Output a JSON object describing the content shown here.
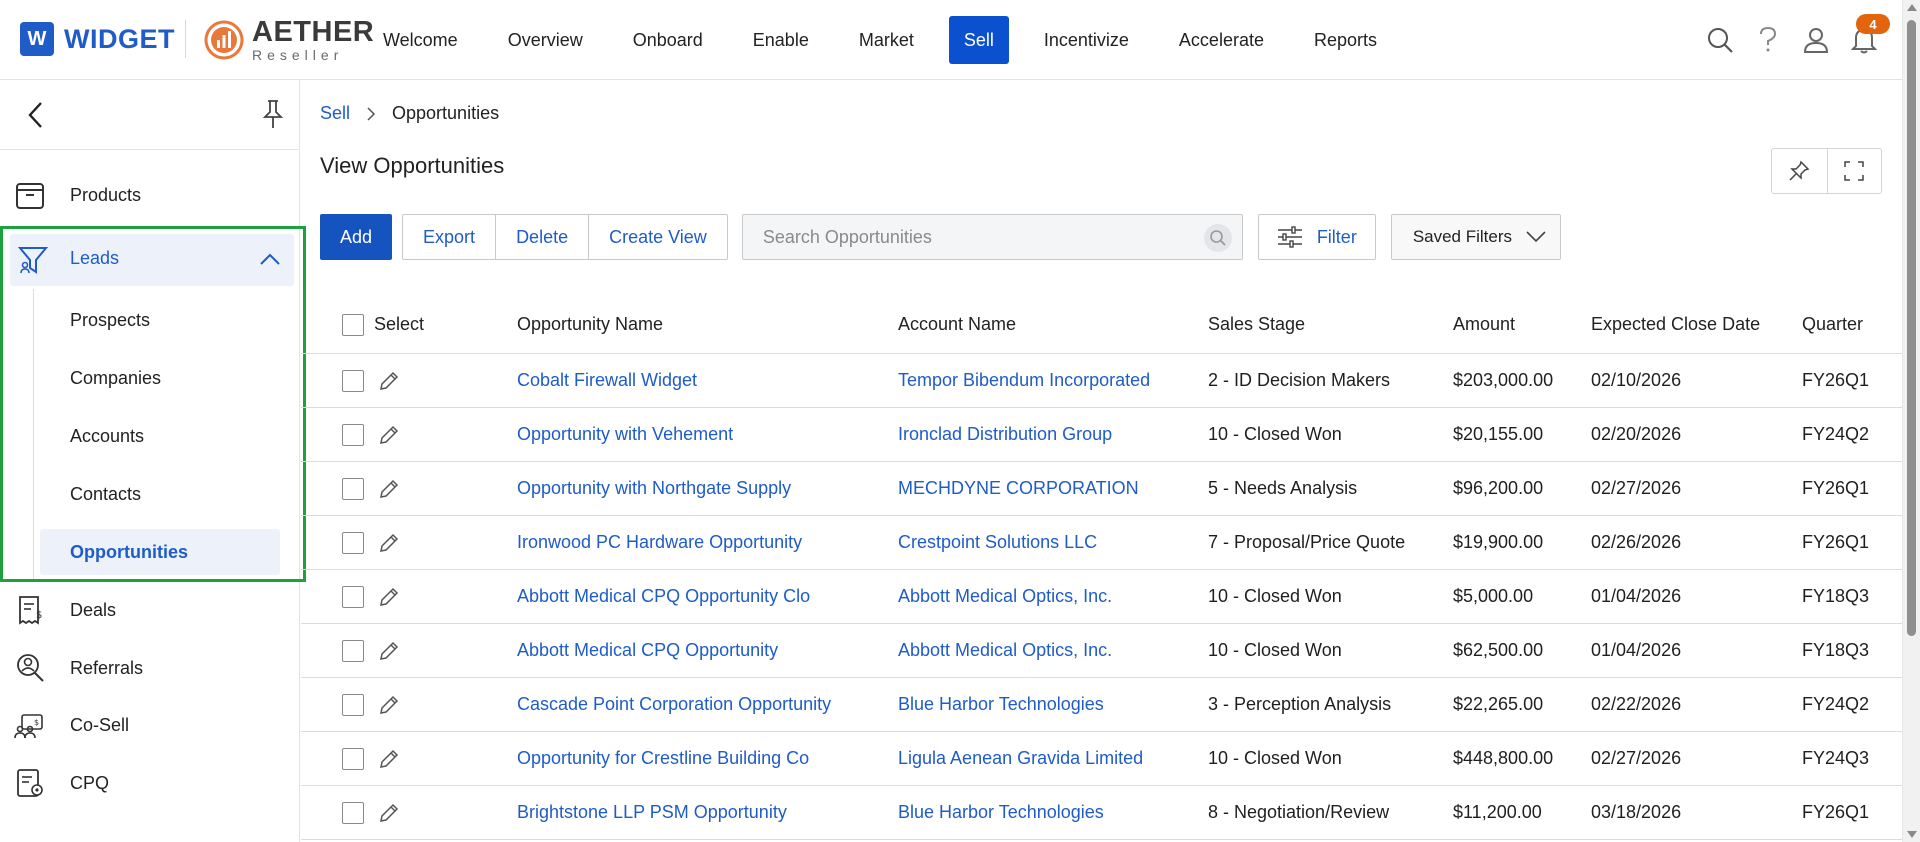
{
  "brand": {
    "widget_letter": "W",
    "widget_name": "WIDGET",
    "aether_name": "AETHER",
    "aether_sub": "Reseller"
  },
  "nav": {
    "items": [
      {
        "label": "Welcome"
      },
      {
        "label": "Overview"
      },
      {
        "label": "Onboard"
      },
      {
        "label": "Enable"
      },
      {
        "label": "Market"
      },
      {
        "label": "Sell",
        "active": true
      },
      {
        "label": "Incentivize"
      },
      {
        "label": "Accelerate"
      },
      {
        "label": "Reports"
      }
    ]
  },
  "header_icons": {
    "search": "search-icon",
    "help": "help-icon",
    "user": "user-icon",
    "notifications": "bell-icon",
    "notification_count": "4"
  },
  "sidebar": {
    "back_icon": "chevron-left-icon",
    "pin_icon": "pin-icon",
    "items": [
      {
        "label": "Products",
        "icon": "box-icon"
      },
      {
        "label": "Leads",
        "icon": "funnel-icon",
        "expanded": true
      },
      {
        "label": "Deals",
        "icon": "receipt-dollar-icon"
      },
      {
        "label": "Referrals",
        "icon": "referral-icon"
      },
      {
        "label": "Co-Sell",
        "icon": "co-sell-icon"
      },
      {
        "label": "CPQ",
        "icon": "cpq-icon"
      }
    ],
    "leads_sub": [
      {
        "label": "Prospects"
      },
      {
        "label": "Companies"
      },
      {
        "label": "Accounts"
      },
      {
        "label": "Contacts"
      },
      {
        "label": "Opportunities",
        "active": true
      }
    ],
    "highlight_color": "#1fa03f"
  },
  "breadcrumb": {
    "parent": "Sell",
    "current": "Opportunities"
  },
  "page": {
    "title": "View Opportunities"
  },
  "toolbar": {
    "add": "Add",
    "export": "Export",
    "delete": "Delete",
    "create_view": "Create View",
    "search_placeholder": "Search Opportunities",
    "filter": "Filter",
    "saved_filters": "Saved Filters"
  },
  "table": {
    "columns": {
      "select": "Select",
      "name": "Opportunity Name",
      "account": "Account Name",
      "stage": "Sales Stage",
      "amount": "Amount",
      "close_date": "Expected Close Date",
      "quarter": "Quarter"
    },
    "rows": [
      {
        "name": "Cobalt Firewall Widget",
        "account": "Tempor Bibendum Incorporated",
        "stage": "2 - ID Decision Makers",
        "amount": "$203,000.00",
        "close_date": "02/10/2026",
        "quarter": "FY26Q1"
      },
      {
        "name": "Opportunity with Vehement",
        "account": "Ironclad Distribution Group",
        "stage": "10 - Closed Won",
        "amount": "$20,155.00",
        "close_date": "02/20/2026",
        "quarter": "FY24Q2"
      },
      {
        "name": "Opportunity with Northgate Supply",
        "account": "MECHDYNE CORPORATION",
        "stage": "5 - Needs Analysis",
        "amount": "$96,200.00",
        "close_date": "02/27/2026",
        "quarter": "FY26Q1"
      },
      {
        "name": "Ironwood PC Hardware Opportunity",
        "account": "Crestpoint Solutions LLC",
        "stage": "7 - Proposal/Price Quote",
        "amount": "$19,900.00",
        "close_date": "02/26/2026",
        "quarter": "FY26Q1"
      },
      {
        "name": "Abbott Medical CPQ Opportunity Clo",
        "account": "Abbott Medical Optics, Inc.",
        "stage": "10 - Closed Won",
        "amount": "$5,000.00",
        "close_date": "01/04/2026",
        "quarter": "FY18Q3"
      },
      {
        "name": "Abbott Medical CPQ Opportunity",
        "account": "Abbott Medical Optics, Inc.",
        "stage": "10 - Closed Won",
        "amount": "$62,500.00",
        "close_date": "01/04/2026",
        "quarter": "FY18Q3"
      },
      {
        "name": "Cascade Point Corporation Opportunity",
        "account": "Blue Harbor Technologies",
        "stage": "3 - Perception Analysis",
        "amount": "$22,265.00",
        "close_date": "02/22/2026",
        "quarter": "FY24Q2"
      },
      {
        "name": "Opportunity for Crestline Building Co",
        "account": "Ligula Aenean Gravida Limited",
        "stage": "10 - Closed Won",
        "amount": "$448,800.00",
        "close_date": "02/27/2026",
        "quarter": "FY24Q3"
      },
      {
        "name": "Brightstone LLP PSM Opportunity",
        "account": "Blue Harbor Technologies",
        "stage": "8 - Negotiation/Review",
        "amount": "$11,200.00",
        "close_date": "03/18/2026",
        "quarter": "FY26Q1"
      }
    ]
  },
  "colors": {
    "primary": "#1554bf",
    "link": "#1f5cc8",
    "nav_active": "#0a50cf",
    "badge": "#e2640c"
  }
}
